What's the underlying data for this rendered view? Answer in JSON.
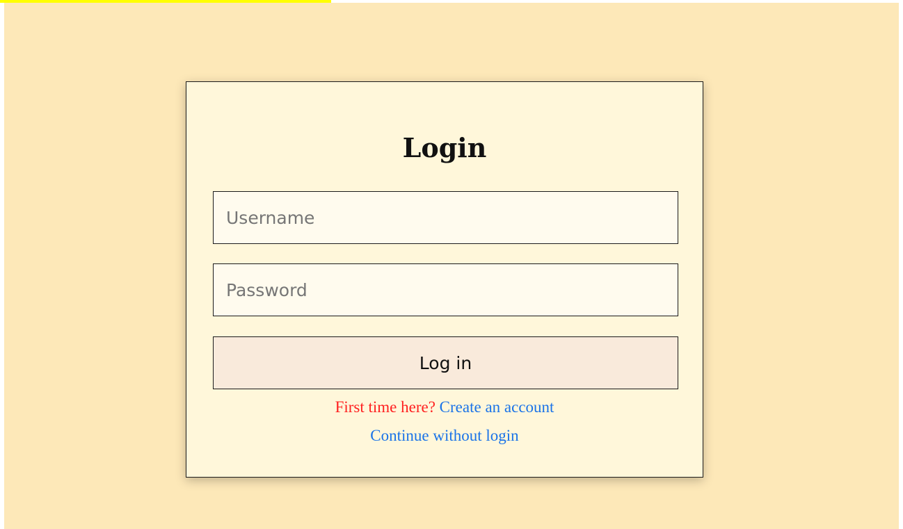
{
  "colors": {
    "page_background": "#fde8b8",
    "card_background": "#fff7da",
    "button_background": "#f9eadb",
    "prompt_color": "#ff1f1f",
    "link_color": "#1a73e8",
    "top_strip": "#ffff00"
  },
  "login": {
    "title": "Login",
    "username_placeholder": "Username",
    "password_placeholder": "Password",
    "submit_label": "Log in",
    "signup_prompt": "First time here?",
    "signup_link": "Create an account",
    "guest_link": "Continue without login"
  }
}
